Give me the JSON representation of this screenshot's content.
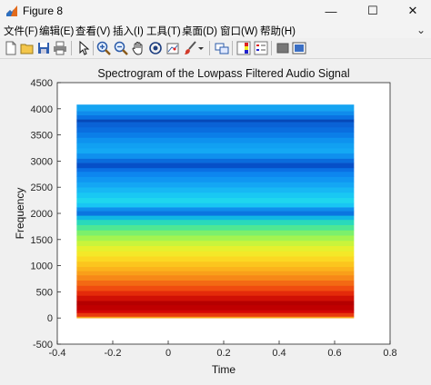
{
  "window": {
    "title": "Figure 8",
    "minimize_glyph": "—",
    "maximize_glyph": "☐",
    "close_glyph": "✕"
  },
  "menu": {
    "items": [
      "文件(F)",
      "编辑(E)",
      "查看(V)",
      "插入(I)",
      "工具(T)",
      "桌面(D)",
      "窗口(W)",
      "帮助(H)"
    ],
    "collapse_glyph": "⌄"
  },
  "toolbar": {
    "icons": [
      "new-figure-icon",
      "open-file-icon",
      "save-icon",
      "print-icon",
      "edit-plot-arrow-icon",
      "zoom-in-icon",
      "zoom-out-icon",
      "pan-hand-icon",
      "rotate-3d-icon",
      "data-cursor-icon",
      "brush-icon",
      "brush-dropdown-icon",
      "link-plot-icon",
      "colorbar-icon",
      "legend-icon",
      "hide-plot-tools-icon",
      "show-plot-tools-icon"
    ]
  },
  "chart_data": {
    "type": "heatmap",
    "title": "Spectrogram of the Lowpass Filtered Audio Signal",
    "xlabel": "Time",
    "ylabel": "Frequency",
    "xlim": [
      -0.4,
      0.8
    ],
    "ylim": [
      -500,
      4500
    ],
    "x_ticks": [
      "-0.4",
      "-0.2",
      "0",
      "0.2",
      "0.4",
      "0.6",
      "0.8"
    ],
    "y_ticks": [
      "-500",
      "0",
      "500",
      "1000",
      "1500",
      "2000",
      "2500",
      "3000",
      "3500",
      "4000",
      "4500"
    ],
    "time_range": [
      -0.33,
      0.67
    ],
    "freq_range": [
      0,
      4080
    ],
    "colormap": "jet",
    "grid": false,
    "bands": [
      {
        "f0": 0,
        "f1": 30,
        "color": "#f7a01a"
      },
      {
        "f0": 30,
        "f1": 100,
        "color": "#e83a10"
      },
      {
        "f0": 100,
        "f1": 150,
        "color": "#d40606"
      },
      {
        "f0": 150,
        "f1": 250,
        "color": "#c00000"
      },
      {
        "f0": 250,
        "f1": 330,
        "color": "#b50000"
      },
      {
        "f0": 330,
        "f1": 430,
        "color": "#d01005"
      },
      {
        "f0": 430,
        "f1": 520,
        "color": "#e42a0a"
      },
      {
        "f0": 520,
        "f1": 620,
        "color": "#f04c10"
      },
      {
        "f0": 620,
        "f1": 720,
        "color": "#f36a14"
      },
      {
        "f0": 720,
        "f1": 820,
        "color": "#f78818"
      },
      {
        "f0": 820,
        "f1": 900,
        "color": "#f99f1a"
      },
      {
        "f0": 900,
        "f1": 980,
        "color": "#fbb31c"
      },
      {
        "f0": 980,
        "f1": 1080,
        "color": "#fbc51e"
      },
      {
        "f0": 1080,
        "f1": 1180,
        "color": "#fbd823"
      },
      {
        "f0": 1180,
        "f1": 1280,
        "color": "#f4e828"
      },
      {
        "f0": 1280,
        "f1": 1380,
        "color": "#e6f02e"
      },
      {
        "f0": 1380,
        "f1": 1480,
        "color": "#c9f43b"
      },
      {
        "f0": 1480,
        "f1": 1580,
        "color": "#a4f450"
      },
      {
        "f0": 1580,
        "f1": 1680,
        "color": "#7cf06c"
      },
      {
        "f0": 1680,
        "f1": 1780,
        "color": "#4ee794"
      },
      {
        "f0": 1780,
        "f1": 1880,
        "color": "#2ad9bb"
      },
      {
        "f0": 1880,
        "f1": 1960,
        "color": "#10b8e4"
      },
      {
        "f0": 1960,
        "f1": 2050,
        "color": "#0a76e0"
      },
      {
        "f0": 2050,
        "f1": 2120,
        "color": "#0e8fec"
      },
      {
        "f0": 2120,
        "f1": 2200,
        "color": "#18c6f4"
      },
      {
        "f0": 2200,
        "f1": 2300,
        "color": "#1fd6ee"
      },
      {
        "f0": 2300,
        "f1": 2400,
        "color": "#19c8f3"
      },
      {
        "f0": 2400,
        "f1": 2500,
        "color": "#17b8f4"
      },
      {
        "f0": 2500,
        "f1": 2600,
        "color": "#14a6f4"
      },
      {
        "f0": 2600,
        "f1": 2700,
        "color": "#1096f2"
      },
      {
        "f0": 2700,
        "f1": 2800,
        "color": "#0d86ef"
      },
      {
        "f0": 2800,
        "f1": 2870,
        "color": "#0a70e4"
      },
      {
        "f0": 2870,
        "f1": 2970,
        "color": "#0650c8"
      },
      {
        "f0": 2970,
        "f1": 3050,
        "color": "#0a6cdc"
      },
      {
        "f0": 3050,
        "f1": 3150,
        "color": "#0f90ee"
      },
      {
        "f0": 3150,
        "f1": 3250,
        "color": "#14a8f4"
      },
      {
        "f0": 3250,
        "f1": 3350,
        "color": "#11a0f2"
      },
      {
        "f0": 3350,
        "f1": 3450,
        "color": "#0e92ef"
      },
      {
        "f0": 3450,
        "f1": 3550,
        "color": "#0b7ee8"
      },
      {
        "f0": 3550,
        "f1": 3650,
        "color": "#0a6edf"
      },
      {
        "f0": 3650,
        "f1": 3750,
        "color": "#0a62d6"
      },
      {
        "f0": 3750,
        "f1": 3800,
        "color": "#0648b8"
      },
      {
        "f0": 3800,
        "f1": 3880,
        "color": "#0a72e2"
      },
      {
        "f0": 3880,
        "f1": 3960,
        "color": "#0f8cec"
      },
      {
        "f0": 3960,
        "f1": 4080,
        "color": "#15a4f2"
      }
    ]
  }
}
